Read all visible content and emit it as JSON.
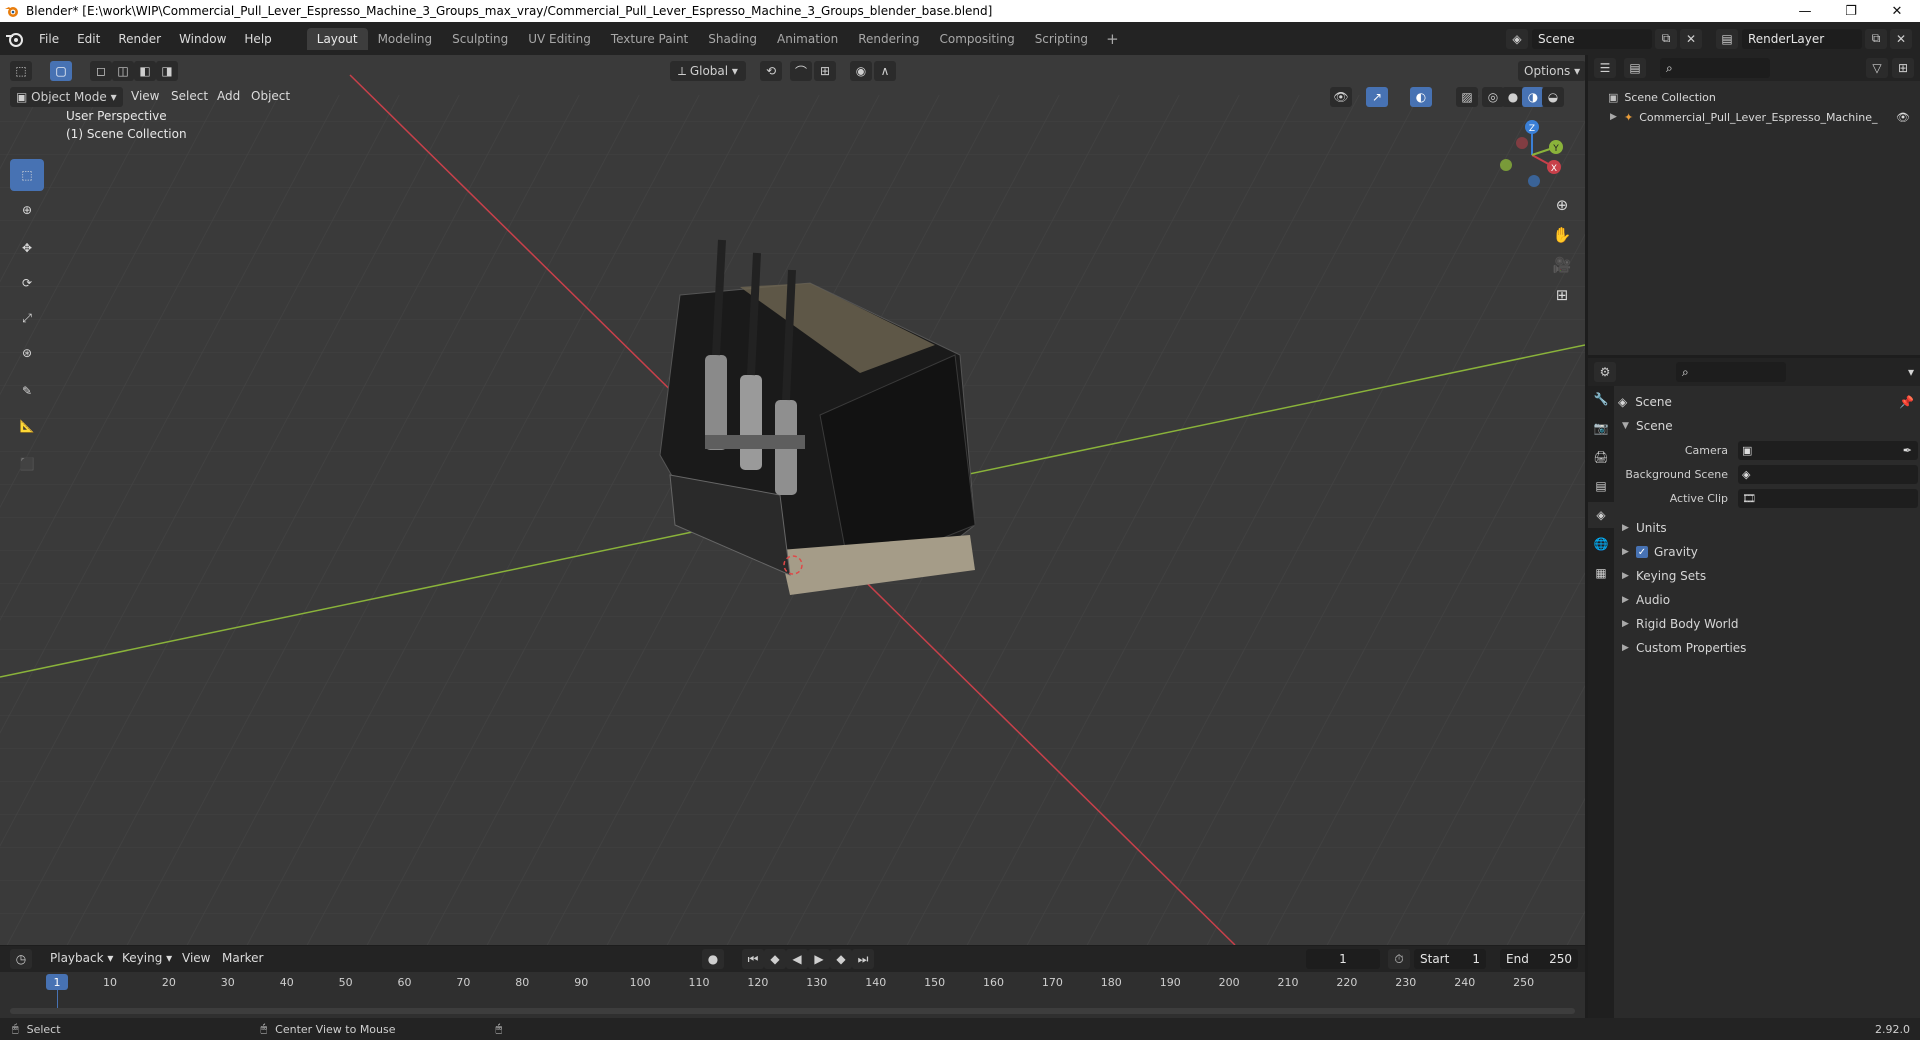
{
  "window": {
    "title": "Blender* [E:\\work\\WIP\\Commercial_Pull_Lever_Espresso_Machine_3_Groups_max_vray/Commercial_Pull_Lever_Espresso_Machine_3_Groups_blender_base.blend]",
    "minimize": "—",
    "restore": "❐",
    "close": "✕"
  },
  "menu": [
    "File",
    "Edit",
    "Render",
    "Window",
    "Help"
  ],
  "workspaces": [
    "Layout",
    "Modeling",
    "Sculpting",
    "UV Editing",
    "Texture Paint",
    "Shading",
    "Animation",
    "Rendering",
    "Compositing",
    "Scripting"
  ],
  "workspace_add": "+",
  "scene_field": "Scene",
  "renderlayer_field": "RenderLayer",
  "viewport": {
    "mode": "Object Mode",
    "menus": [
      "View",
      "Select",
      "Add",
      "Object"
    ],
    "orientation": "Global",
    "options": "Options",
    "info_line1": "User Perspective",
    "info_line2": "(1) Scene Collection",
    "gizmo": {
      "x": "X",
      "y": "Y",
      "z": "Z"
    }
  },
  "outliner": {
    "root": "Scene Collection",
    "item": "Commercial_Pull_Lever_Espresso_Machine_"
  },
  "properties": {
    "context": "Scene",
    "panel_title": "Scene",
    "camera_label": "Camera",
    "bg_scene_label": "Background Scene",
    "active_clip_label": "Active Clip",
    "panels": [
      "Units",
      "Gravity",
      "Keying Sets",
      "Audio",
      "Rigid Body World",
      "Custom Properties"
    ]
  },
  "timeline": {
    "menus": [
      "Playback",
      "Keying",
      "View",
      "Marker"
    ],
    "current_frame": "1",
    "start_label": "Start",
    "start_value": "1",
    "end_label": "End",
    "end_value": "250",
    "ticks": [
      "1",
      "10",
      "20",
      "30",
      "40",
      "50",
      "60",
      "70",
      "80",
      "90",
      "100",
      "110",
      "120",
      "130",
      "140",
      "150",
      "160",
      "170",
      "180",
      "190",
      "200",
      "210",
      "220",
      "230",
      "240",
      "250"
    ]
  },
  "status": {
    "select": "Select",
    "center_view": "Center View to Mouse",
    "version": "2.92.0"
  },
  "colors": {
    "accent": "#4772b3",
    "x_axis": "#c8404a",
    "y_axis": "#8ab33a",
    "z_axis": "#3a7fd6"
  }
}
